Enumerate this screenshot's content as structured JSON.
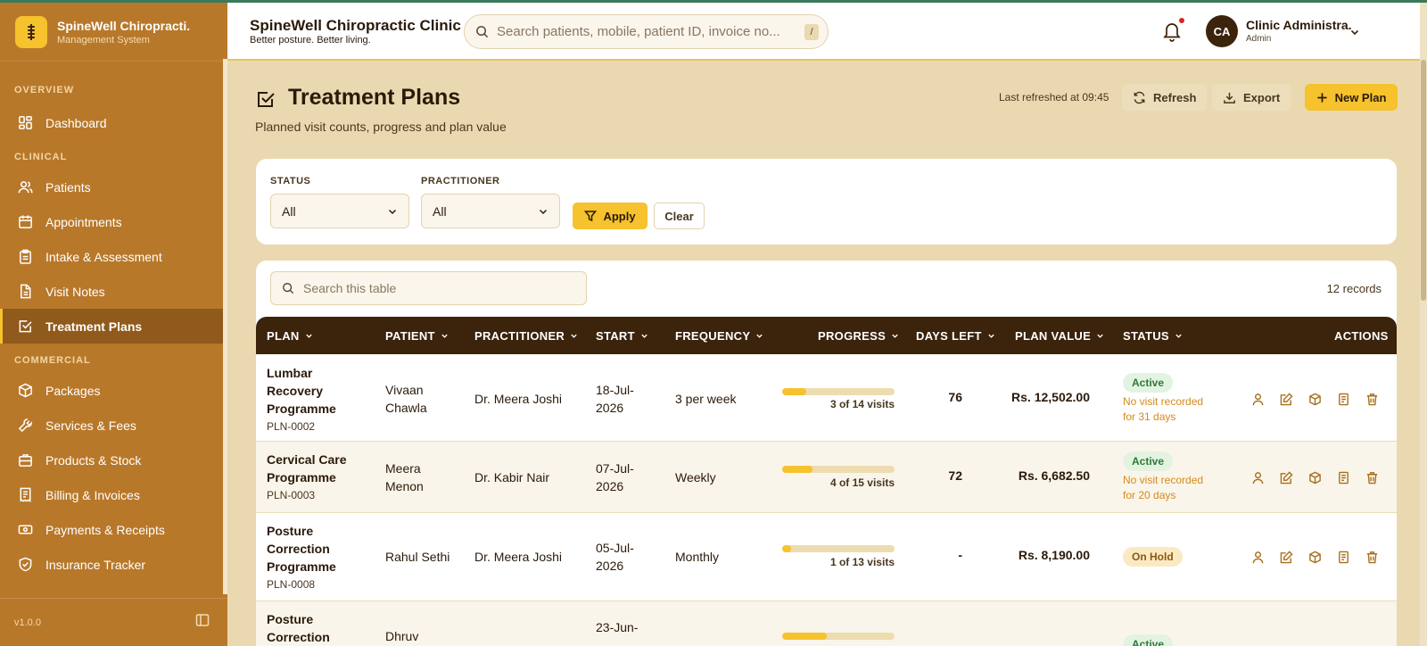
{
  "brand": {
    "name": "SpineWell Chiropracti.",
    "subtitle": "Management System"
  },
  "sidebar": {
    "sections": [
      {
        "label": "OVERVIEW",
        "items": [
          {
            "label": "Dashboard",
            "icon": "dashboard-icon"
          }
        ]
      },
      {
        "label": "CLINICAL",
        "items": [
          {
            "label": "Patients",
            "icon": "users-icon"
          },
          {
            "label": "Appointments",
            "icon": "calendar-icon"
          },
          {
            "label": "Intake & Assessment",
            "icon": "clipboard-icon"
          },
          {
            "label": "Visit Notes",
            "icon": "document-icon"
          },
          {
            "label": "Treatment Plans",
            "icon": "checkbox-icon",
            "active": true
          }
        ]
      },
      {
        "label": "COMMERCIAL",
        "items": [
          {
            "label": "Packages",
            "icon": "package-icon"
          },
          {
            "label": "Services & Fees",
            "icon": "wrench-icon"
          },
          {
            "label": "Products & Stock",
            "icon": "briefcase-icon"
          },
          {
            "label": "Billing & Invoices",
            "icon": "receipt-icon"
          },
          {
            "label": "Payments & Receipts",
            "icon": "cash-icon"
          },
          {
            "label": "Insurance Tracker",
            "icon": "shield-icon"
          }
        ]
      }
    ],
    "version": "v1.0.0"
  },
  "header": {
    "clinic_name": "SpineWell Chiropractic Clinic",
    "tagline": "Better posture. Better living.",
    "search_placeholder": "Search patients, mobile, patient ID, invoice no...",
    "search_shortcut": "/",
    "user_initials": "CA",
    "user_name": "Clinic Administra.",
    "user_role": "Admin"
  },
  "page": {
    "title": "Treatment Plans",
    "subtitle": "Planned visit counts, progress and plan value",
    "last_refreshed": "Last refreshed at 09:45",
    "refresh_label": "Refresh",
    "export_label": "Export",
    "new_plan_label": "New Plan"
  },
  "filters": {
    "status_label": "STATUS",
    "status_value": "All",
    "practitioner_label": "PRACTITIONER",
    "practitioner_value": "All",
    "apply_label": "Apply",
    "clear_label": "Clear"
  },
  "table": {
    "search_placeholder": "Search this table",
    "record_count": "12 records",
    "columns": [
      "PLAN",
      "PATIENT",
      "PRACTITIONER",
      "START",
      "FREQUENCY",
      "PROGRESS",
      "DAYS LEFT",
      "PLAN VALUE",
      "STATUS",
      "ACTIONS"
    ],
    "rows": [
      {
        "plan_lines": [
          "Lumbar",
          "Recovery",
          "Programme"
        ],
        "plan_id": "PLN-0002",
        "patient_lines": [
          "Vivaan",
          "Chawla"
        ],
        "practitioner": "Dr. Meera Joshi",
        "start_lines": [
          "18-Jul-",
          "2026"
        ],
        "frequency": "3 per week",
        "progress": 0.214,
        "progress_text": "3 of 14 visits",
        "days_left": "76",
        "plan_value": "Rs. 12,502.00",
        "status": "Active",
        "warning_lines": [
          "No visit recorded",
          "for 31 days"
        ]
      },
      {
        "plan_lines": [
          "Cervical Care",
          "Programme"
        ],
        "plan_id": "PLN-0003",
        "patient_lines": [
          "Meera",
          "Menon"
        ],
        "practitioner": "Dr. Kabir Nair",
        "start_lines": [
          "07-Jul-",
          "2026"
        ],
        "frequency": "Weekly",
        "progress": 0.267,
        "progress_text": "4 of 15 visits",
        "days_left": "72",
        "plan_value": "Rs. 6,682.50",
        "status": "Active",
        "warning_lines": [
          "No visit recorded",
          "for 20 days"
        ]
      },
      {
        "plan_lines": [
          "Posture",
          "Correction",
          "Programme"
        ],
        "plan_id": "PLN-0008",
        "patient_lines": [
          "Rahul Sethi"
        ],
        "practitioner": "Dr. Meera Joshi",
        "start_lines": [
          "05-Jul-",
          "2026"
        ],
        "frequency": "Monthly",
        "progress": 0.077,
        "progress_text": "1 of 13 visits",
        "days_left": "-",
        "plan_value": "Rs. 8,190.00",
        "status": "On Hold",
        "warning_lines": []
      },
      {
        "plan_lines": [
          "Posture",
          "Correction"
        ],
        "plan_id": "",
        "patient_lines": [
          "Dhruv"
        ],
        "practitioner": "",
        "start_lines": [
          "23-Jun-"
        ],
        "frequency": "",
        "progress": 0.4,
        "progress_text": "",
        "days_left": "",
        "plan_value": "",
        "status": "Active",
        "warning_lines": []
      }
    ]
  },
  "colors": {
    "sidebar": "#b8782a",
    "accent": "#f6c22d",
    "table_header": "#3b230c",
    "page_bg": "#ead9b0"
  }
}
